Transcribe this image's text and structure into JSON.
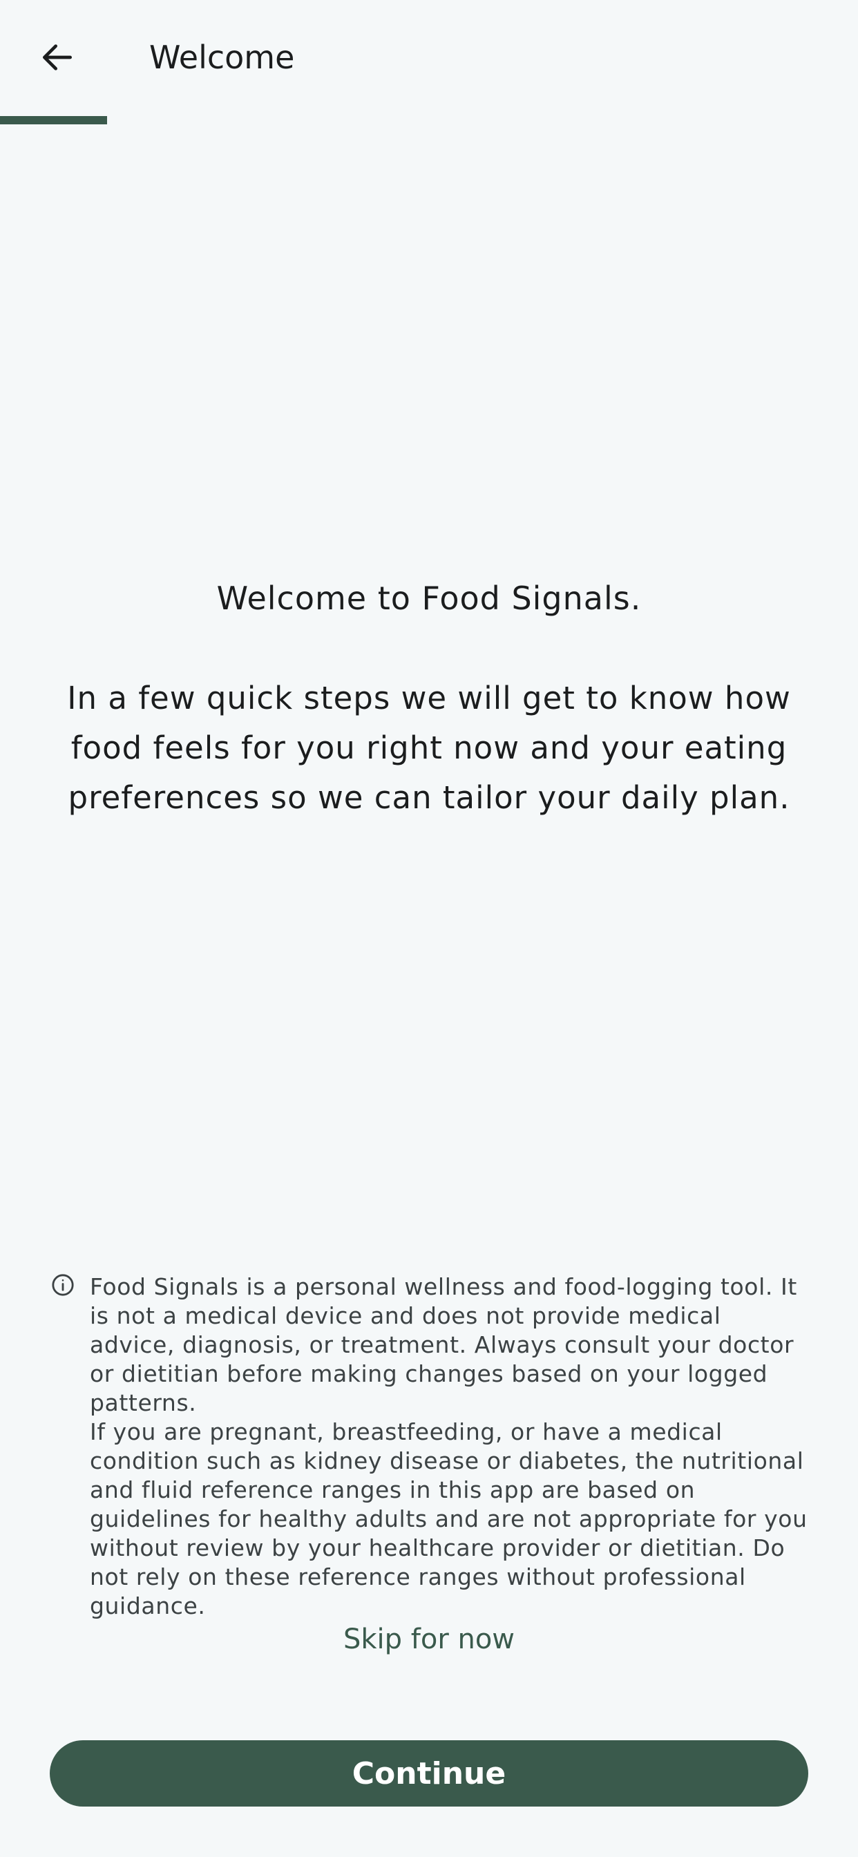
{
  "header": {
    "back_icon": "arrow-left-icon",
    "title": "Welcome"
  },
  "progress": {
    "value_fraction": 0.125,
    "color": "#3a5a4c"
  },
  "intro": {
    "title": "Welcome to Food Signals.",
    "body": "In a few quick steps we will get to know how food feels for you right now and your eating preferences so we can tailor your daily plan."
  },
  "disclaimer": {
    "icon": "info-icon",
    "paragraph_1": "Food Signals is a personal wellness and food-logging tool. It is not a medical device and does not provide medical advice, diagnosis, or treatment. Always consult your doctor or dietitian before making changes based on your logged patterns.",
    "paragraph_2": "If you are pregnant, breastfeeding, or have a medical condition such as kidney disease or diabetes, the nutritional and fluid reference ranges in this app are based on guidelines for healthy adults and are not appropriate for you without review by your healthcare provider or dietitian. Do not rely on these reference ranges without professional guidance."
  },
  "actions": {
    "skip_label": "Skip for now",
    "continue_label": "Continue"
  },
  "colors": {
    "accent": "#3a5a4c",
    "background": "#f5f8f9"
  }
}
